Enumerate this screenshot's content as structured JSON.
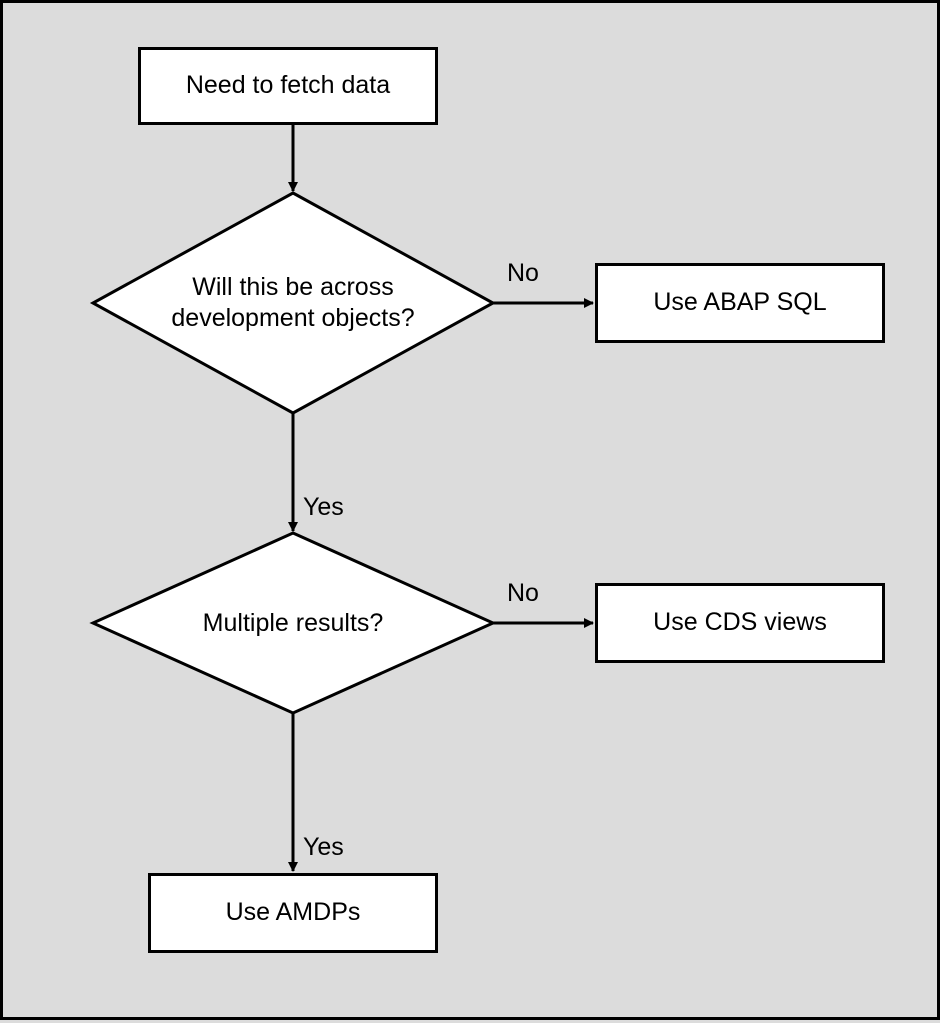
{
  "nodes": {
    "start": "Need to fetch data",
    "decision1": "Will this be across development objects?",
    "decision2": "Multiple results?",
    "abap_sql": "Use ABAP SQL",
    "cds_views": "Use CDS views",
    "amdps": "Use AMDPs"
  },
  "edges": {
    "d1_no": "No",
    "d1_yes": "Yes",
    "d2_no": "No",
    "d2_yes": "Yes"
  }
}
